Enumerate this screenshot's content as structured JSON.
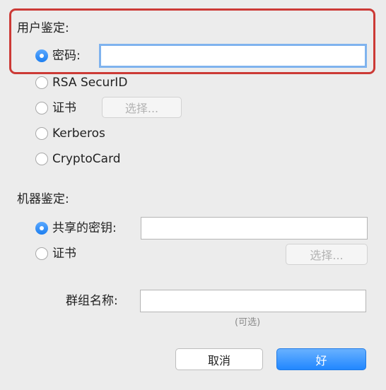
{
  "user_auth": {
    "title": "用户鉴定:",
    "options": [
      {
        "label": "密码:",
        "checked": true
      },
      {
        "label": "RSA SecurID",
        "checked": false
      },
      {
        "label": "证书",
        "checked": false
      },
      {
        "label": "Kerberos",
        "checked": false
      },
      {
        "label": "CryptoCard",
        "checked": false
      }
    ],
    "password_value": "",
    "choose_label": "选择..."
  },
  "machine_auth": {
    "title": "机器鉴定:",
    "options": [
      {
        "label": "共享的密钥:",
        "checked": true
      },
      {
        "label": "证书",
        "checked": false
      }
    ],
    "shared_secret_value": "",
    "choose_label": "选择..."
  },
  "group": {
    "label": "群组名称:",
    "value": "",
    "hint": "(可选)"
  },
  "footer": {
    "cancel_label": "取消",
    "ok_label": "好"
  },
  "colors": {
    "accent": "#2187ff",
    "highlight": "#cc3a36",
    "background": "#ececec"
  }
}
